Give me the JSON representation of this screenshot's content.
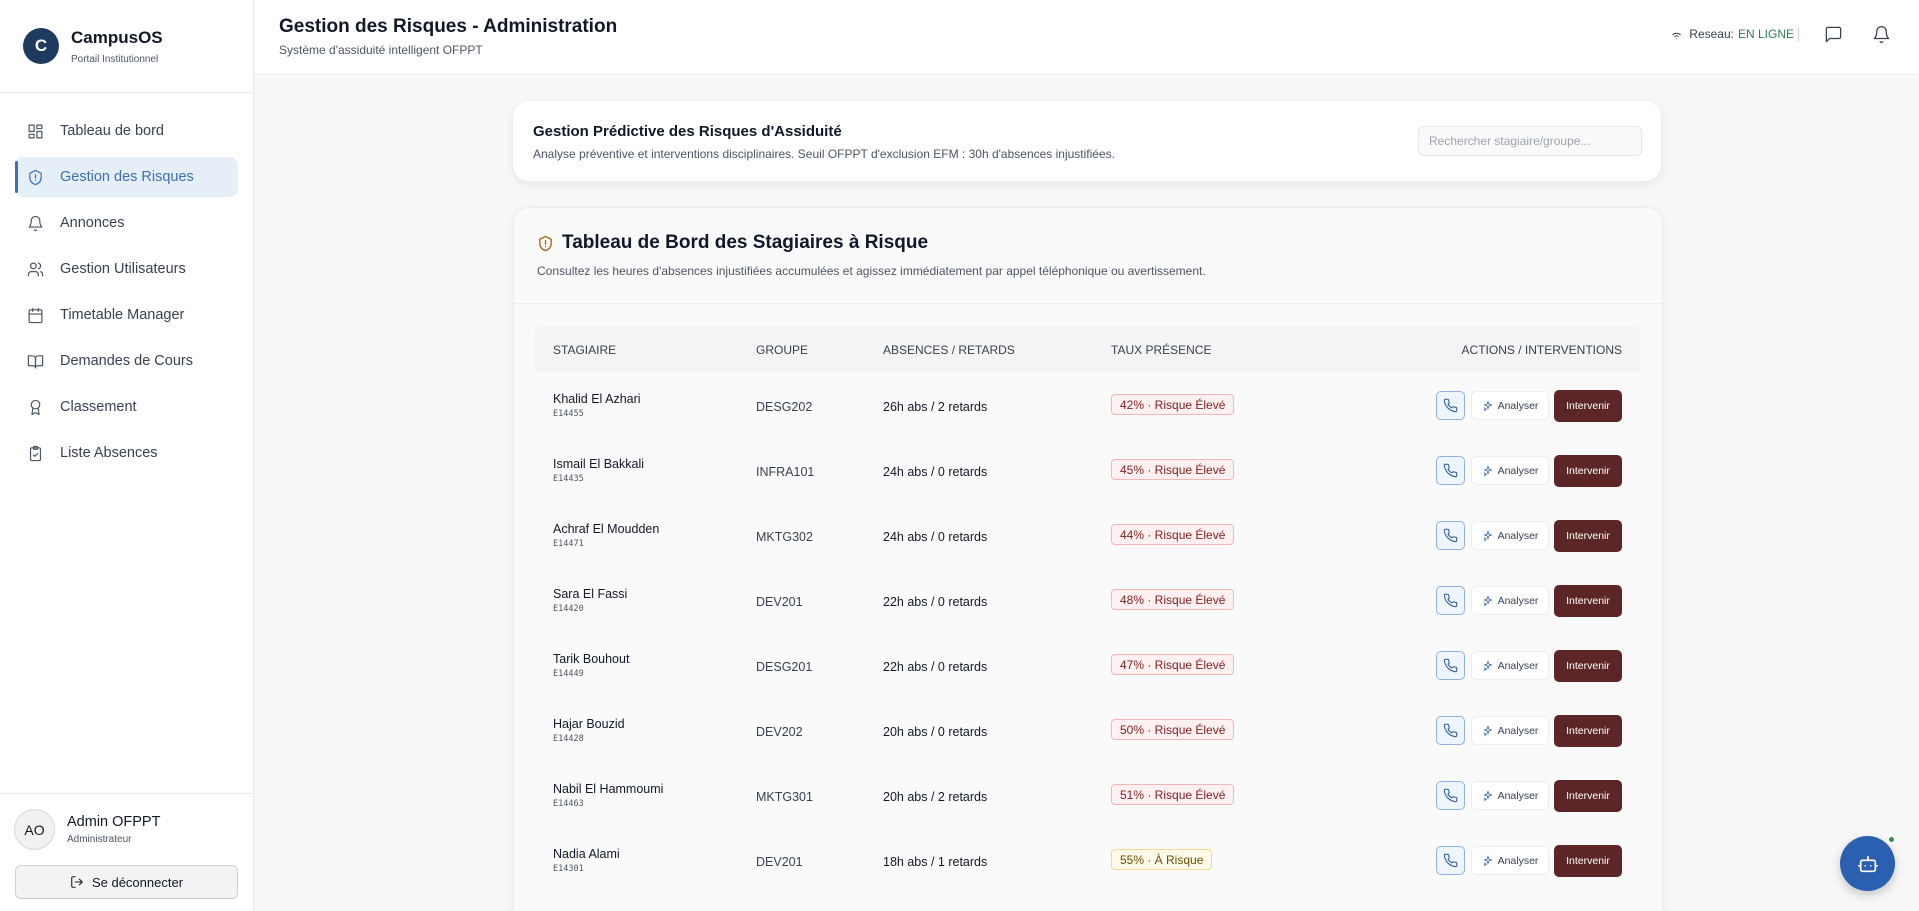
{
  "brand": {
    "initial": "C",
    "name": "CampusOS",
    "subtitle": "Portail Institutionnel"
  },
  "sidebar": {
    "items": [
      {
        "label": "Tableau de bord",
        "icon": "dashboard-icon"
      },
      {
        "label": "Gestion des Risques",
        "icon": "shield-icon",
        "active": true
      },
      {
        "label": "Annonces",
        "icon": "bell-icon"
      },
      {
        "label": "Gestion Utilisateurs",
        "icon": "users-icon"
      },
      {
        "label": "Timetable Manager",
        "icon": "calendar-icon"
      },
      {
        "label": "Demandes de Cours",
        "icon": "book-icon"
      },
      {
        "label": "Classement",
        "icon": "award-icon"
      },
      {
        "label": "Liste Absences",
        "icon": "clipboard-check-icon"
      }
    ]
  },
  "user": {
    "initials": "AO",
    "name": "Admin OFPPT",
    "role": "Administrateur",
    "logout_label": "Se déconnecter"
  },
  "header": {
    "title": "Gestion des Risques - Administration",
    "subtitle": "Système d'assiduité intelligent OFPPT",
    "network_label": "Reseau:",
    "network_status": "EN LIGNE"
  },
  "intro": {
    "title": "Gestion Prédictive des Risques d'Assiduité",
    "subtitle": "Analyse préventive et interventions disciplinaires. Seuil OFPPT d'exclusion EFM : 30h d'absences injustifiées.",
    "search_placeholder": "Rechercher stagiaire/groupe..."
  },
  "panel": {
    "title": "Tableau de Bord des Stagiaires à Risque",
    "subtitle": "Consultez les heures d'absences injustifiées accumulées et agissez immédiatement par appel téléphonique ou avertissement."
  },
  "table": {
    "columns": [
      "STAGIAIRE",
      "GROUPE",
      "ABSENCES / RETARDS",
      "TAUX PRÉSENCE",
      "ACTIONS / INTERVENTIONS"
    ],
    "analyse_label": "Analyser",
    "intervene_label": "Intervenir",
    "rows": [
      {
        "name": "Khalid El Azhari",
        "id": "E14455",
        "group": "DESG202",
        "absences": "26h abs / 2 retards",
        "presence": "42% · Risque Élevé",
        "level": "high"
      },
      {
        "name": "Ismail El Bakkali",
        "id": "E14435",
        "group": "INFRA101",
        "absences": "24h abs / 0 retards",
        "presence": "45% · Risque Élevé",
        "level": "high"
      },
      {
        "name": "Achraf El Moudden",
        "id": "E14471",
        "group": "MKTG302",
        "absences": "24h abs / 0 retards",
        "presence": "44% · Risque Élevé",
        "level": "high"
      },
      {
        "name": "Sara El Fassi",
        "id": "E14420",
        "group": "DEV201",
        "absences": "22h abs / 0 retards",
        "presence": "48% · Risque Élevé",
        "level": "high"
      },
      {
        "name": "Tarik Bouhout",
        "id": "E14449",
        "group": "DESG201",
        "absences": "22h abs / 0 retards",
        "presence": "47% · Risque Élevé",
        "level": "high"
      },
      {
        "name": "Hajar Bouzid",
        "id": "E14428",
        "group": "DEV202",
        "absences": "20h abs / 0 retards",
        "presence": "50% · Risque Élevé",
        "level": "high"
      },
      {
        "name": "Nabil El Hammoumi",
        "id": "E14463",
        "group": "MKTG301",
        "absences": "20h abs / 2 retards",
        "presence": "51% · Risque Élevé",
        "level": "high"
      },
      {
        "name": "Nadia Alami",
        "id": "E14301",
        "group": "DEV201",
        "absences": "18h abs / 1 retards",
        "presence": "55% · À Risque",
        "level": "mid"
      }
    ]
  },
  "colors": {
    "primary": "#3b6fb6",
    "brand_dark": "#1e3a5f",
    "intervene": "#5c2626",
    "online": "#2f7d4f"
  }
}
